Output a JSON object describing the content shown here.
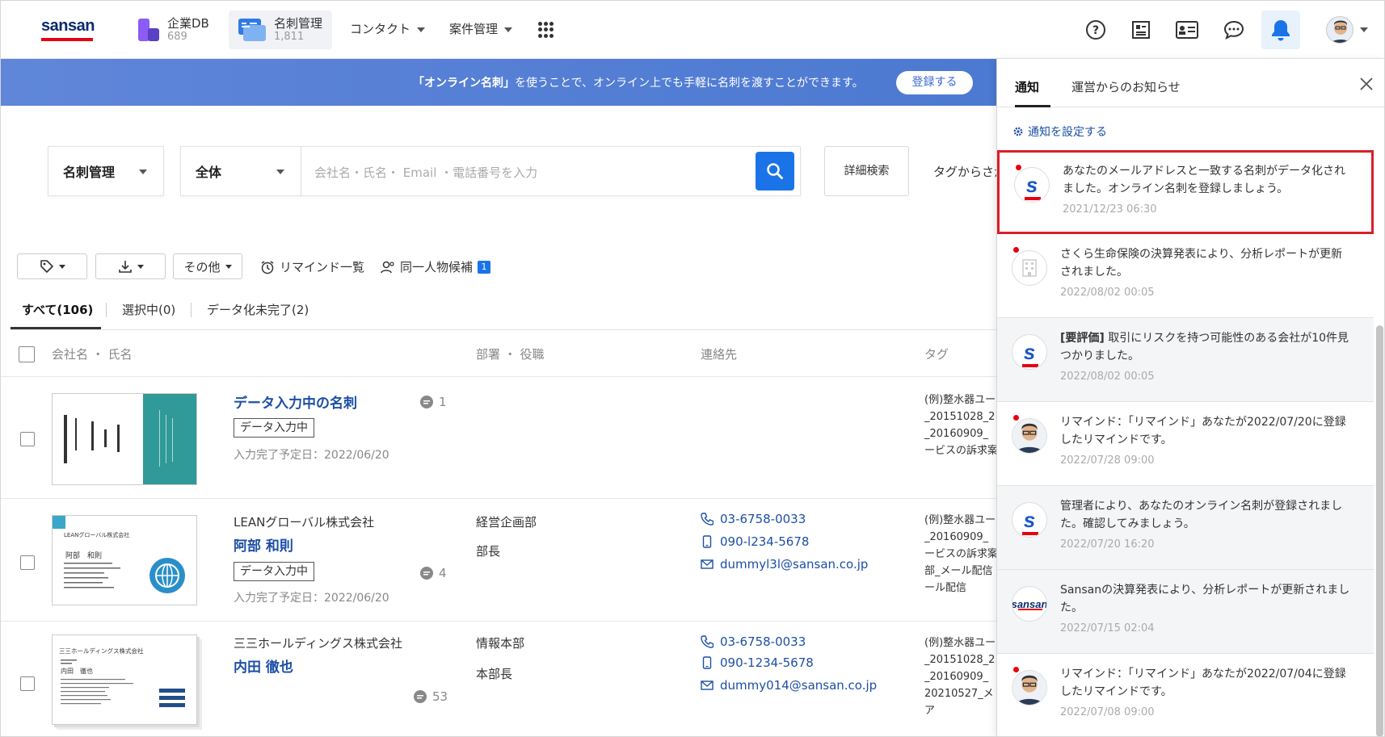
{
  "nav": {
    "logo": "sansan",
    "company_db": {
      "label": "企業DB",
      "count": "689"
    },
    "cards": {
      "label": "名刺管理",
      "count": "1,811"
    },
    "contact": "コンタクト",
    "deals": "案件管理"
  },
  "banner": {
    "highlight": "「オンライン名刺」",
    "text": "を使うことで、オンライン上でも手軽に名刺を渡すことができます。",
    "button": "登録する"
  },
  "search": {
    "scope": "名刺管理",
    "filter": "全体",
    "placeholder": "会社名・氏名・ Email ・電話番号を入力",
    "advanced": "詳細検索",
    "tag_from": "タグからさが"
  },
  "toolbar": {
    "other": "その他",
    "remind_list": "リマインド一覧",
    "same_person": "同一人物候補",
    "same_person_count": "1"
  },
  "tabs": {
    "all": "すべて(106)",
    "selected": "選択中(0)",
    "pending": "データ化未完了(2)"
  },
  "table": {
    "col_name": "会社名 ・ 氏名",
    "col_dept": "部署 ・ 役職",
    "col_contact": "連絡先",
    "col_tag": "タグ",
    "rows": [
      {
        "company": "",
        "name": "データ入力中の名刺",
        "status": "データ入力中",
        "due": "入力完了予定日：2022/06/20",
        "comments": "1",
        "dept": "",
        "title": "",
        "phone": "",
        "mobile": "",
        "email": "",
        "tags": [
          "(例)整水器ユー",
          "_20151028_2",
          "_20160909_",
          "ービスの訴求案"
        ]
      },
      {
        "company": "LEANグローバル株式会社",
        "name": "阿部 和則",
        "status": "データ入力中",
        "due": "入力完了予定日：2022/06/20",
        "comments": "4",
        "dept": "経営企画部",
        "title": "部長",
        "phone": "03-6758-0033",
        "mobile": "090-l234-5678",
        "email": "dummyl3l@sansan.co.jp",
        "tags": [
          "(例)整水器ユー",
          "_20160909_",
          "ービスの訴求案",
          "部_メール配信",
          "ール配信"
        ]
      },
      {
        "company": "三三ホールディングス株式会社",
        "name": "内田 徹也",
        "status": "",
        "due": "",
        "comments": "53",
        "dept": "情報本部",
        "title": "本部長",
        "phone": "03-6758-0033",
        "mobile": "090-1234-5678",
        "email": "dummy014@sansan.co.jp",
        "tags": [
          "(例)整水器ユー",
          "_20151028_2",
          "_20160909_",
          "20210527_メ",
          "ア"
        ]
      }
    ]
  },
  "cards_preview": {
    "card2_company": "LEANグローバル株式会社",
    "card2_name": "阿部　和則",
    "card3_company": "三三ホールディングス株式会社",
    "card3_name": "内田　徹也"
  },
  "panel": {
    "tab_notify": "通知",
    "tab_news": "運営からのお知らせ",
    "settings": "通知を設定する",
    "items": [
      {
        "text": "あなたのメールアドレスと一致する名刺がデータ化されました。オンライン名刺を登録しましょう。",
        "time": "2021/12/23 06:30"
      },
      {
        "text": "さくら生命保険の決算発表により、分析レポートが更新されました。",
        "time": "2022/08/02 00:05"
      },
      {
        "prefix": "[要評価]",
        "text": " 取引にリスクを持つ可能性のある会社が10件見つかりました。",
        "time": "2022/08/02 00:05"
      },
      {
        "text": "リマインド：「リマインド」あなたが2022/07/20に登録したリマインドです。",
        "time": "2022/07/28 09:00"
      },
      {
        "text": "管理者により、あなたのオンライン名刺が登録されました。確認してみましょう。",
        "time": "2022/07/20 16:20"
      },
      {
        "text": "Sansanの決算発表により、分析レポートが更新されました。",
        "time": "2022/07/15 02:04"
      },
      {
        "text": "リマインド：「リマインド」あなたが2022/07/04に登録したリマインドです。",
        "time": "2022/07/08 09:00"
      }
    ]
  },
  "colors": {
    "accent": "#1a74e8",
    "brand_red": "#e60012",
    "link": "#1d4fa5",
    "highlight_border": "#d8202a"
  }
}
